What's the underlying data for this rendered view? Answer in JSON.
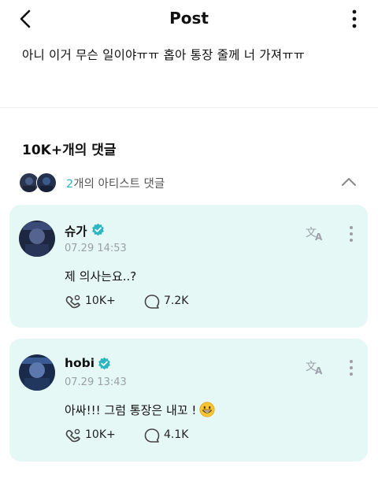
{
  "header": {
    "title": "Post",
    "back_icon": "chevron-left-icon",
    "more_icon": "vertical-dots-icon"
  },
  "post": {
    "text": "아니 이거 무슨 일이야ㅠㅠ 홉아 통장 줄께 너 가져ㅠㅠ"
  },
  "comments": {
    "count_label": "10K+개의 댓글",
    "artist_toggle": {
      "count": "2",
      "label": "개의 아티스트 댓글"
    }
  },
  "artist_comments": [
    {
      "name": "슈가",
      "date": "07.29 14:53",
      "text": "제 의사는요..?",
      "likes": "10K+",
      "replies": "7.2K",
      "emoji": ""
    },
    {
      "name": "hobi",
      "date": "07.29 13:43",
      "text": "아싸!!! 그럼 통장은 내꼬 !",
      "likes": "10K+",
      "replies": "4.1K",
      "emoji": "grinning-face-emoji"
    }
  ],
  "colors": {
    "card_bg": "#e6f8f6",
    "accent": "#2bb6c2",
    "verified": "#2bb6c2",
    "muted": "#9aa0a6"
  }
}
